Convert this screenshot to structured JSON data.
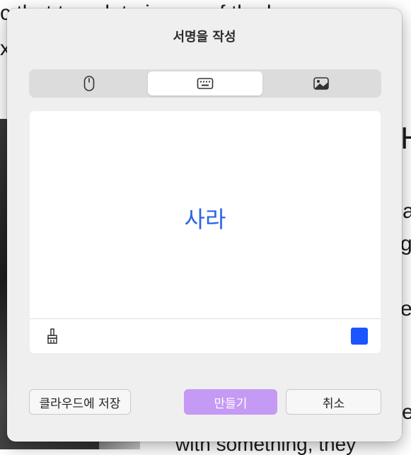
{
  "background": {
    "line1": "c  that  template  is  one  of  the  h",
    "line2": "xl",
    "fragments": [
      "H",
      "a",
      "g",
      "el",
      "e"
    ],
    "bottom_line": "with something, they"
  },
  "dialog": {
    "title": "서명을 작성",
    "tabs": [
      {
        "icon": "trackpad-icon",
        "selected": false
      },
      {
        "icon": "keyboard-icon",
        "selected": true
      },
      {
        "icon": "image-icon",
        "selected": false
      }
    ],
    "signature_text": "사라",
    "signature_color": "#2a64e6",
    "ink_color": "#1a55ff",
    "buttons": {
      "cloud_save": "클라우드에 저장",
      "create": "만들기",
      "cancel": "취소"
    }
  }
}
